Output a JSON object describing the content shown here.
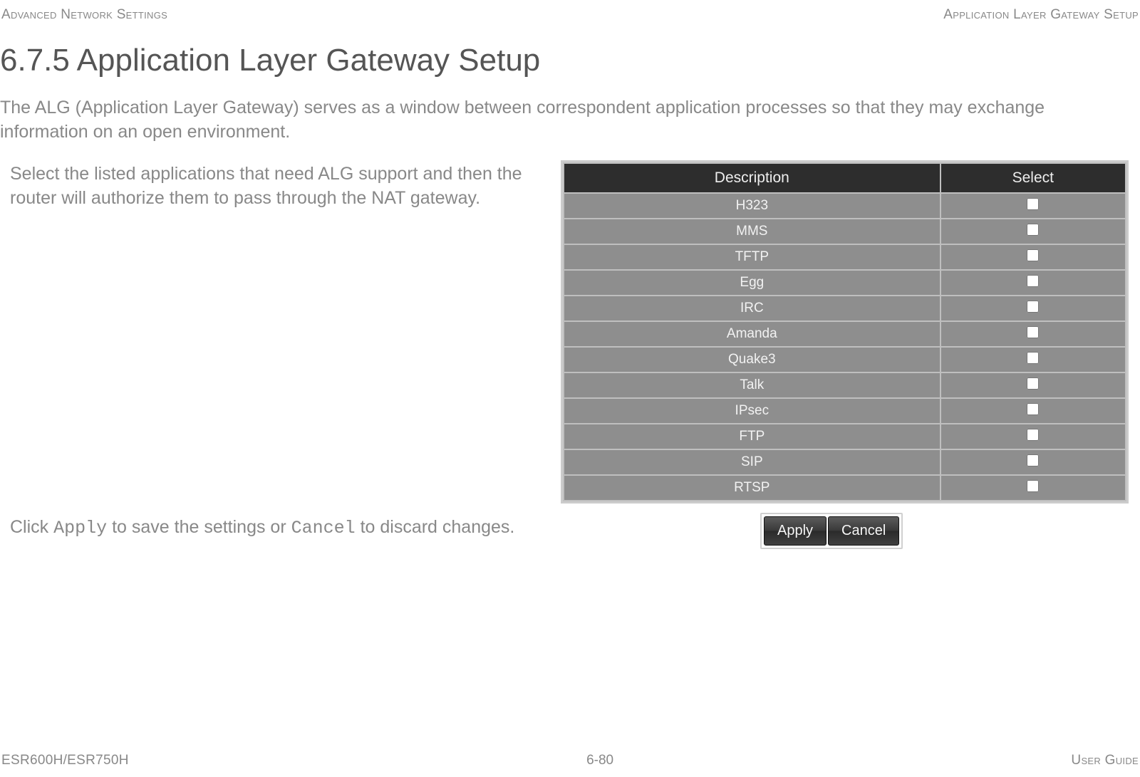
{
  "header": {
    "left": "Advanced Network Settings",
    "right": "Application Layer Gateway Setup"
  },
  "title": "6.7.5 Application Layer Gateway Setup",
  "intro": "The ALG (Application Layer Gateway) serves as a window between correspondent application processes so that they may exchange information on an open environment.",
  "instruction1": "Select the listed applications that need ALG support and then the router will authorize them to pass through the NAT gateway.",
  "instruction2_prefix": "Click ",
  "instruction2_apply": "Apply",
  "instruction2_mid": " to save the settings or ",
  "instruction2_cancel": "Cancel",
  "instruction2_suffix": " to discard changes.",
  "table": {
    "header_desc": "Description",
    "header_sel": "Select",
    "rows": [
      {
        "desc": "H323"
      },
      {
        "desc": "MMS"
      },
      {
        "desc": "TFTP"
      },
      {
        "desc": "Egg"
      },
      {
        "desc": "IRC"
      },
      {
        "desc": "Amanda"
      },
      {
        "desc": "Quake3"
      },
      {
        "desc": "Talk"
      },
      {
        "desc": "IPsec"
      },
      {
        "desc": "FTP"
      },
      {
        "desc": "SIP"
      },
      {
        "desc": "RTSP"
      }
    ]
  },
  "buttons": {
    "apply": "Apply",
    "cancel": "Cancel"
  },
  "footer": {
    "left": "ESR600H/ESR750H",
    "center": "6-80",
    "right": "User Guide"
  }
}
